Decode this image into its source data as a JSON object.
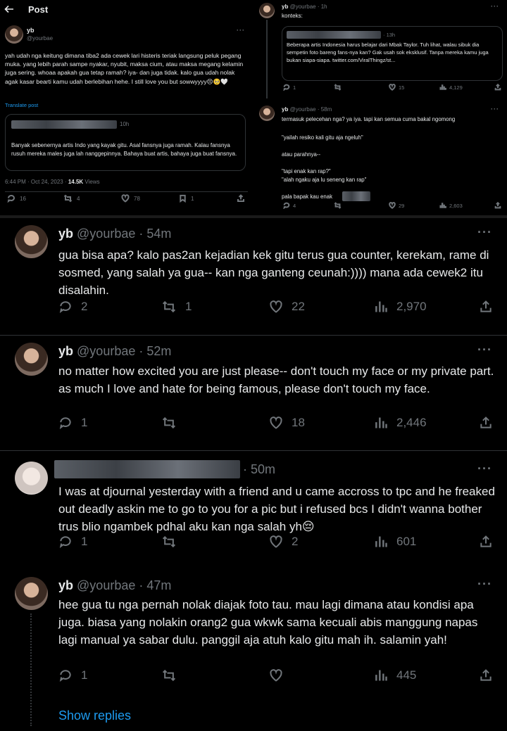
{
  "top_left": {
    "header_title": "Post",
    "author_name": "yb",
    "author_handle": "@yourbae",
    "text": "yah udah nga keitung dimana tiba2 ada cewek lari histeris teriak langsung peluk pegang muka. yang lebih parah sampe nyakar, nyubit, maksa cium, atau maksa megang kelamin juga sering. whoaa apakah gua tetap ramah? iya- dan juga tidak. kalo gua udah nolak agak kasar bearti kamu udah berlebihan hehe. I still love you but sowwyyyy😣🥺🤍",
    "translate": "Translate post",
    "quote_time": "10h",
    "quote_text": "Banyak sebenernya artis Indo yang kayak gitu. Asal fansnya juga ramah. Kalau fansnya rusuh mereka males juga lah nanggepinnya. Bahaya buat artis, bahaya juga buat fansnya.",
    "meta_time": "6:44 PM · Oct 24, 2023 · ",
    "views_count": "14.5K",
    "views_label": " Views",
    "replies": "16",
    "reposts": "4",
    "likes": "78",
    "bookmarks": "1"
  },
  "top_right": {
    "post1": {
      "author_name": "yb",
      "handle_time": "@yourbae · 1h",
      "text": "konteks:",
      "quote_time": "· 13h",
      "quote_text": "Beberapa artis Indonesia harus belajar dari Mbak Taylor. Tuh lihat, walau sibuk dia sempetin foto bareng fans-nya kan? Gak usah sok eksklusif. Tanpa mereka kamu juga bukan siapa-siapa. twitter.com/ViralThingz/st...",
      "replies": "1",
      "reposts": "",
      "likes": "15",
      "views": "4,129"
    },
    "post2": {
      "author_name": "yb",
      "handle_time": "@yourbae · 58m",
      "line1": "termasuk pelecehan nga? ya iya. tapi kan semua cuma bakal ngomong",
      "line2": "\"yailah resiko kali gitu aja ngeluh\"",
      "line3": "atau parahnya--",
      "line4": "\"tapi enak kan rap?\"",
      "line5": "\"alah ngaku aja lu seneng kan rap\"",
      "line6": "pala bapak kau enak",
      "replies": "4",
      "reposts": "",
      "likes": "29",
      "views": "2,603"
    }
  },
  "bottom": {
    "tweets": [
      {
        "author_name": "yb",
        "handle_time": "@yourbae · 54m",
        "text": "gua bisa apa? kalo pas2an kejadian kek gitu terus gua counter, kerekam, rame di sosmed, yang salah ya gua-- kan nga ganteng ceunah:)))) mana ada cewek2 itu disalahin.",
        "replies": "2",
        "reposts": "1",
        "likes": "22",
        "views": "2,970"
      },
      {
        "author_name": "yb",
        "handle_time": "@yourbae · 52m",
        "text": "no matter how excited you are just please-- don't touch my face or my private part. as much I love and hate for being famous, please don't touch my face.",
        "replies": "1",
        "reposts": "",
        "likes": "18",
        "views": "2,446"
      },
      {
        "author_name": "",
        "handle_time": "· 50m",
        "text": "I was at djournal yesterday with a friend and u came accross to tpc and he freaked out deadly askin me to go to you for a pic but i refused bcs I didn't wanna bother trus blio ngambek pdhal aku kan nga salah yh😔",
        "replies": "1",
        "reposts": "",
        "likes": "2",
        "views": "601"
      },
      {
        "author_name": "yb",
        "handle_time": "@yourbae · 47m",
        "text": "hee gua tu nga pernah nolak diajak foto tau. mau lagi dimana atau kondisi apa juga. biasa yang nolakin orang2 gua wkwk sama kecuali abis manggung napas lagi manual ya sabar dulu. panggil aja atuh kalo gitu mah ih. salamin yah!",
        "replies": "1",
        "reposts": "",
        "likes": "",
        "views": "445"
      }
    ],
    "show_replies": "Show replies"
  },
  "colors": {
    "background": "#000000",
    "text": "#e7e9ea",
    "muted": "#71767b",
    "link": "#1d9bf0",
    "border": "#2f3336"
  }
}
